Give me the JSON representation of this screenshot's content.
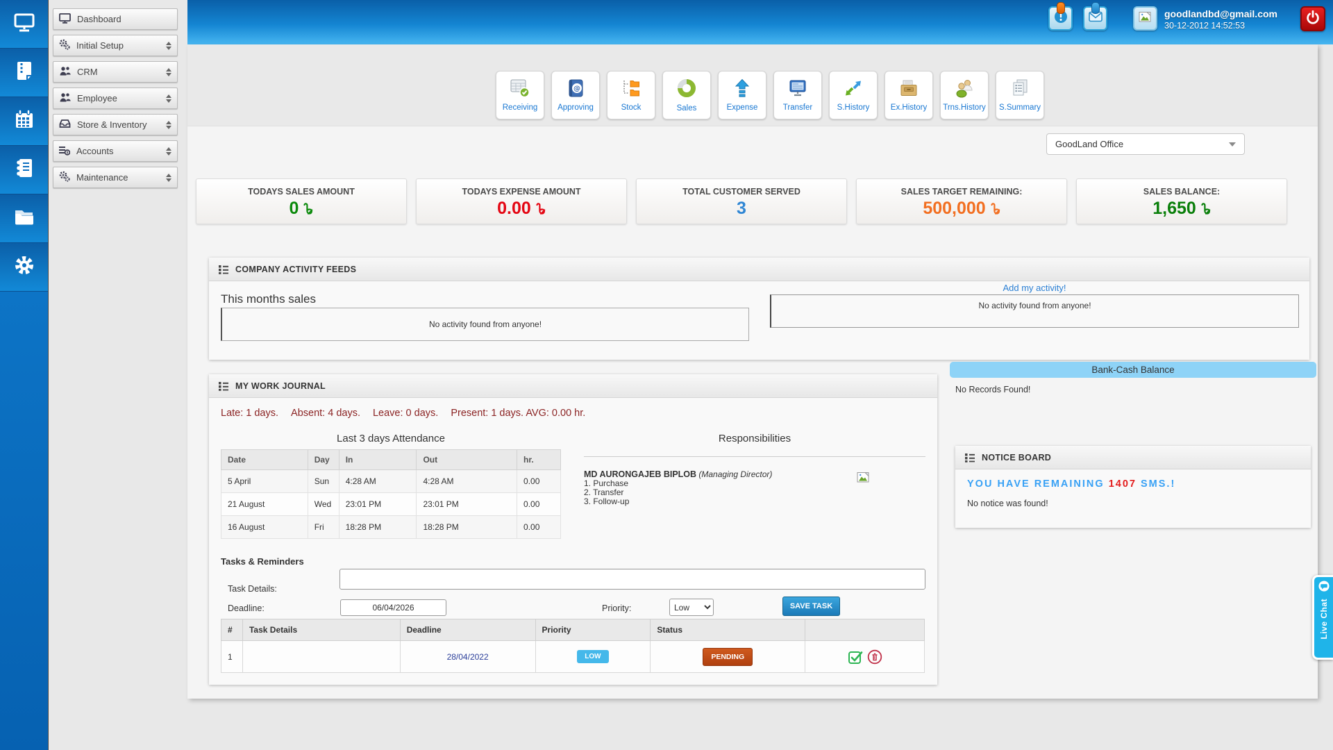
{
  "header": {
    "email": "goodlandbd@gmail.com",
    "datetime": "30-12-2012 14:52:53"
  },
  "sidebar": {
    "rail_icons": [
      "monitor-icon",
      "zip-document-icon",
      "calendar-icon",
      "journal-icon",
      "folder-icon",
      "gear-icon"
    ],
    "menu": [
      {
        "label": "Dashboard",
        "icon": "monitor-icon"
      },
      {
        "label": "Initial Setup",
        "icon": "gears-icon"
      },
      {
        "label": "CRM",
        "icon": "people-icon"
      },
      {
        "label": "Employee",
        "icon": "people-icon"
      },
      {
        "label": "Store & Inventory",
        "icon": "inbox-icon"
      },
      {
        "label": "Accounts",
        "icon": "accounts-icon"
      },
      {
        "label": "Maintenance",
        "icon": "gears-icon"
      }
    ]
  },
  "toolbar": {
    "buttons": [
      {
        "label": "Receiving",
        "icon": "spreadsheet-check-icon"
      },
      {
        "label": "Approving",
        "icon": "address-book-icon"
      },
      {
        "label": "Stock",
        "icon": "folder-tree-icon"
      },
      {
        "label": "Sales",
        "icon": "donut-chart-icon"
      },
      {
        "label": "Expense",
        "icon": "up-arrow-icon"
      },
      {
        "label": "Transfer",
        "icon": "monitor-icon"
      },
      {
        "label": "S.History",
        "icon": "swap-arrows-icon"
      },
      {
        "label": "Ex.History",
        "icon": "archive-box-icon"
      },
      {
        "label": "Trns.History",
        "icon": "two-people-icon"
      },
      {
        "label": "S.Summary",
        "icon": "documents-icon"
      }
    ]
  },
  "office_select": {
    "value": "GoodLand Office"
  },
  "stats": {
    "cards": [
      {
        "label": "TODAYS SALES AMOUNT",
        "value": "0",
        "currency": "taka",
        "color": "#0c8a0c"
      },
      {
        "label": "TODAYS EXPENSE AMOUNT",
        "value": "0.00",
        "currency": "taka",
        "color": "#e40613"
      },
      {
        "label": "TOTAL CUSTOMER SERVED",
        "value": "3",
        "currency": "",
        "color": "#2f86d4"
      },
      {
        "label": "SALES TARGET REMAINING:",
        "value": "500,000",
        "currency": "taka",
        "color": "#f26f21"
      },
      {
        "label": "SALES BALANCE:",
        "value": "1,650",
        "currency": "taka",
        "color": "#0a7f0a"
      }
    ]
  },
  "activity": {
    "title": "COMPANY ACTIVITY FEEDS",
    "chart_title": "This months sales",
    "chart_empty": "No activity found from anyone!",
    "add_link": "Add my activity!",
    "feed_empty": "No activity found from anyone!"
  },
  "bank_cash": {
    "title": "Bank-Cash Balance",
    "empty": "No Records Found!"
  },
  "journal": {
    "title": "MY WORK JOURNAL",
    "summary": {
      "color": "#8b2323",
      "parts": [
        "Late: 1 days.",
        "Absent: 4 days.",
        "Leave: 0 days.",
        "Present: 1 days. AVG: 0.00 hr."
      ]
    },
    "attendance": {
      "title": "Last 3 days Attendance",
      "headers": [
        "Date",
        "Day",
        "In",
        "Out",
        "hr."
      ],
      "rows": [
        {
          "date": "5 April",
          "day": "Sun",
          "in": "4:28 AM",
          "out": "4:28 AM",
          "hr": "0.00"
        },
        {
          "date": "21 August",
          "day": "Wed",
          "in": "23:01 PM",
          "out": "23:01 PM",
          "hr": "0.00"
        },
        {
          "date": "16 August",
          "day": "Fri",
          "in": "18:28 PM",
          "out": "18:28 PM",
          "hr": "0.00"
        }
      ]
    },
    "responsibilities": {
      "title": "Responsibilities",
      "name": "MD AURONGAJEB BIPLOB",
      "role": "(Managing Director)",
      "duties": [
        "1. Purchase",
        "2. Transfer",
        "3. Follow-up"
      ]
    },
    "tasks": {
      "title": "Tasks & Reminders",
      "details_label": "Task Details:",
      "deadline_label": "Deadline:",
      "deadline_value": "06/04/2026",
      "priority_label": "Priority:",
      "priority_value": "Low",
      "save_button": "SAVE TASK",
      "table": {
        "headers": [
          "#",
          "Task Details",
          "Deadline",
          "Priority",
          "Status"
        ],
        "row": {
          "num": "1",
          "details": "",
          "deadline": "28/04/2022",
          "priority": "LOW",
          "status": "PENDING"
        },
        "deadline_color": "#2b3f9a"
      }
    }
  },
  "notice": {
    "title": "NOTICE BOARD",
    "sms_prefix": "YOU HAVE REMAINING",
    "sms_count": "1407",
    "sms_suffix": "SMS.!",
    "empty": "No notice was found!",
    "accent_blue": "#38a1f5",
    "accent_red": "#e31c1c"
  },
  "live_chat": {
    "label": "Live Chat"
  }
}
